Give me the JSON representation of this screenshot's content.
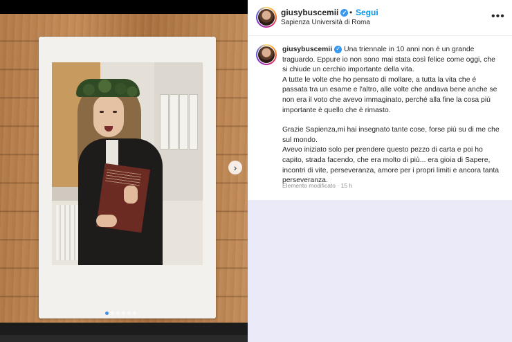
{
  "post": {
    "username": "giusybuscemii",
    "follow_label": "Segui",
    "separator": "•",
    "location": "Sapienza Università di Roma",
    "more_label": "•••",
    "caption": {
      "line1": "Una triennale in 10 anni non è un grande traguardo. Eppure io non sono mai stata così felice come oggi, che si chiude un cerchio importante della vita.",
      "line2": "A tutte le volte che ho pensato di mollare, a tutta la vita che é passata tra un esame e l'altro, alle volte che andava bene anche se non era il voto che avevo immaginato, perché alla fine la cosa più importante è quello che è rimasto.",
      "line3": "Grazie Sapienza,mi hai insegnato tante cose, forse più su di me che sul mondo.",
      "line4": "Avevo iniziato solo per prendere questo pezzo di carta e poi ho capito, strada facendo, che era molto di più... era gioia di Sapere, incontri di vite, perseveranza, amore per i propri limiti e ancora tanta perseveranza."
    },
    "edited_meta": "Elemento modificato · 15 h"
  },
  "carousel": {
    "next_icon": "›",
    "dot_count": 6,
    "active_dot": 0
  },
  "colors": {
    "link": "#0095f6",
    "verified": "#3897f0",
    "active_dot": "#4a90e2"
  }
}
